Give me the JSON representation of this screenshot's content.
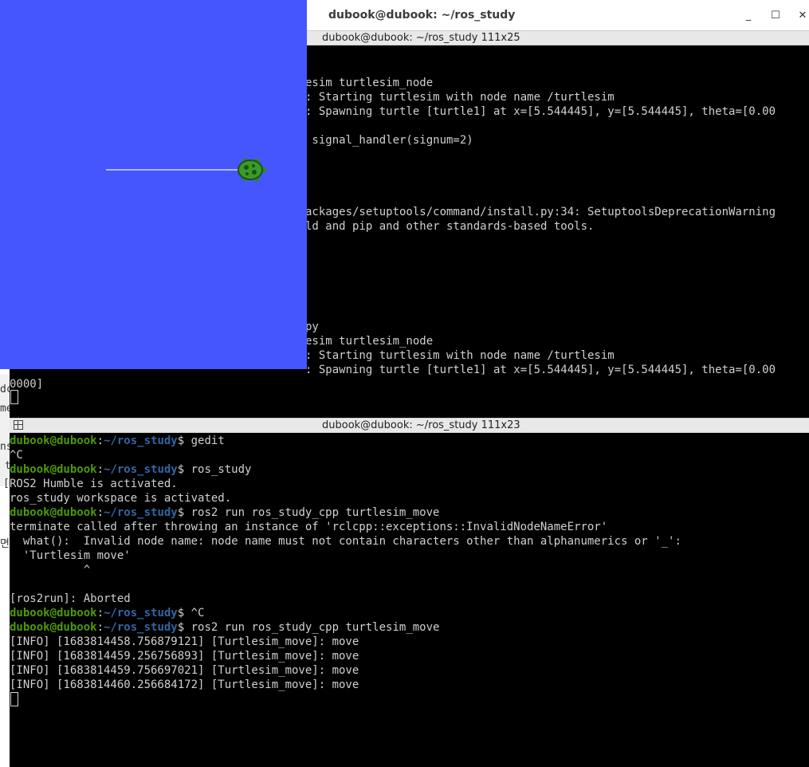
{
  "window": {
    "title": "dubook@dubook: ~/ros_study",
    "minimize": "_",
    "maximize": "☐",
    "close": "✕"
  },
  "top_pane": {
    "title": "dubook@dubook: ~/ros_study 111x25",
    "lines": [
      "esim turtlesim_node",
      ": Starting turtlesim with node name /turtlesim",
      ": Spawning turtle [turtle1] at x=[5.544445], y=[5.544445], theta=[0.00",
      "",
      " signal_handler(signum=2)",
      "",
      "",
      "",
      "",
      "ackages/setuptools/command/install.py:34: SetuptoolsDeprecationWarning",
      "ld and pip and other standards-based tools.",
      "",
      "",
      "",
      "",
      "",
      "",
      "py",
      "esim turtlesim_node",
      ": Starting turtlesim with node name /turtlesim",
      ": Spawning turtle [turtle1] at x=[5.544445], y=[5.544445], theta=[0.00",
      "0000]"
    ]
  },
  "bottom_pane": {
    "title": "dubook@dubook: ~/ros_study 111x23",
    "prompt_user": "dubook@dubook",
    "prompt_path": "~/ros_study",
    "lines": [
      {
        "prompt": true,
        "text": " gedit"
      },
      {
        "text": "^C"
      },
      {
        "prompt": true,
        "text": " ros_study"
      },
      {
        "text": "ROS2 Humble is activated."
      },
      {
        "text": "ros_study workspace is activated."
      },
      {
        "prompt": true,
        "text": " ros2 run ros_study_cpp turtlesim_move"
      },
      {
        "text": "terminate called after throwing an instance of 'rclcpp::exceptions::InvalidNodeNameError'"
      },
      {
        "text": "  what():  Invalid node name: node name must not contain characters other than alphanumerics or '_':"
      },
      {
        "text": "  'Turtlesim move'"
      },
      {
        "text": "           ^"
      },
      {
        "text": ""
      },
      {
        "text": "[ros2run]: Aborted"
      },
      {
        "prompt": true,
        "text": " ^C"
      },
      {
        "prompt": true,
        "text": " ros2 run ros_study_cpp turtlesim_move"
      },
      {
        "text": "[INFO] [1683814458.756879121] [Turtlesim_move]: move"
      },
      {
        "text": "[INFO] [1683814459.256756893] [Turtlesim_move]: move"
      },
      {
        "text": "[INFO] [1683814459.756697021] [Turtlesim_move]: move"
      },
      {
        "text": "[INFO] [1683814460.256684172] [Turtlesim_move]: move"
      }
    ]
  },
  "background_fragments": [
    "dc",
    "me",
    "ns",
    "t",
    "[",
    "면"
  ],
  "turtlesim": {
    "background_color": "#4556ff",
    "pen_color": "#b3b8ff",
    "turtle_icon": "turtle-icon"
  }
}
